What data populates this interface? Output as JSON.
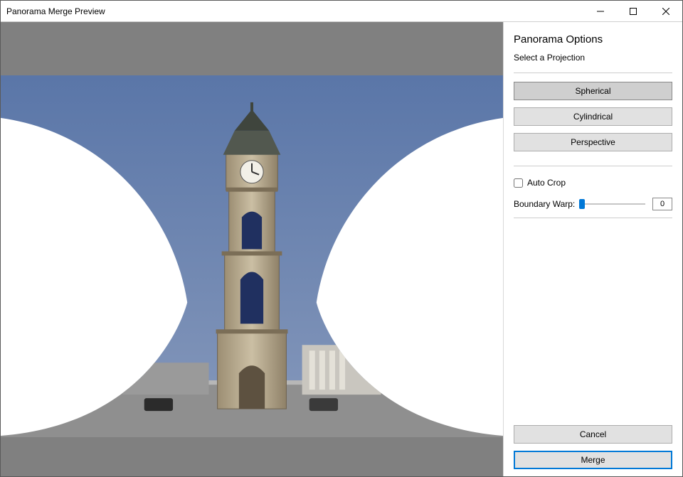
{
  "window": {
    "title": "Panorama Merge Preview"
  },
  "panel": {
    "heading": "Panorama Options",
    "projection_label": "Select a Projection",
    "projections": {
      "spherical": "Spherical",
      "cylindrical": "Cylindrical",
      "perspective": "Perspective"
    },
    "auto_crop_label": "Auto Crop",
    "auto_crop_checked": false,
    "boundary_warp_label": "Boundary Warp:",
    "boundary_warp_value": "0"
  },
  "actions": {
    "cancel": "Cancel",
    "merge": "Merge"
  }
}
